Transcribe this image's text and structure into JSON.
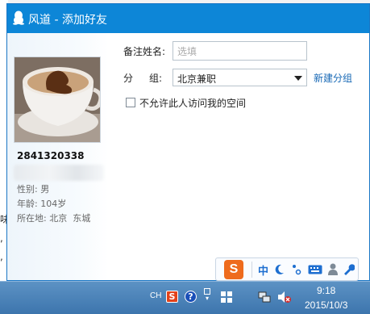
{
  "window": {
    "title": "风道 - 添加好友",
    "icon": "penguin-icon"
  },
  "profile": {
    "qq_number": "2841320338",
    "gender_label": "性别:",
    "gender": "男",
    "age_label": "年龄:",
    "age": "104岁",
    "location_label": "所在地:",
    "location": "北京  东城"
  },
  "form": {
    "remark_label": "备注姓名:",
    "remark_placeholder": "选填",
    "group_label_1": "分",
    "group_label_2": "组:",
    "group_value": "北京兼职",
    "new_group_link": "新建分组",
    "privacy_checkbox_label": "不允许此人访问我的空间",
    "privacy_checked": false
  },
  "ime_toolbar": {
    "logo": "S",
    "mode": "中",
    "items": [
      "moon-icon",
      "punctuation-icon",
      "keyboard-icon",
      "user-icon",
      "wrench-icon"
    ]
  },
  "taskbar": {
    "lang": "CH",
    "time": "9:18",
    "date": "2015/10/3"
  },
  "background": {
    "left_chars": [
      "味",
      ",",
      ","
    ]
  }
}
